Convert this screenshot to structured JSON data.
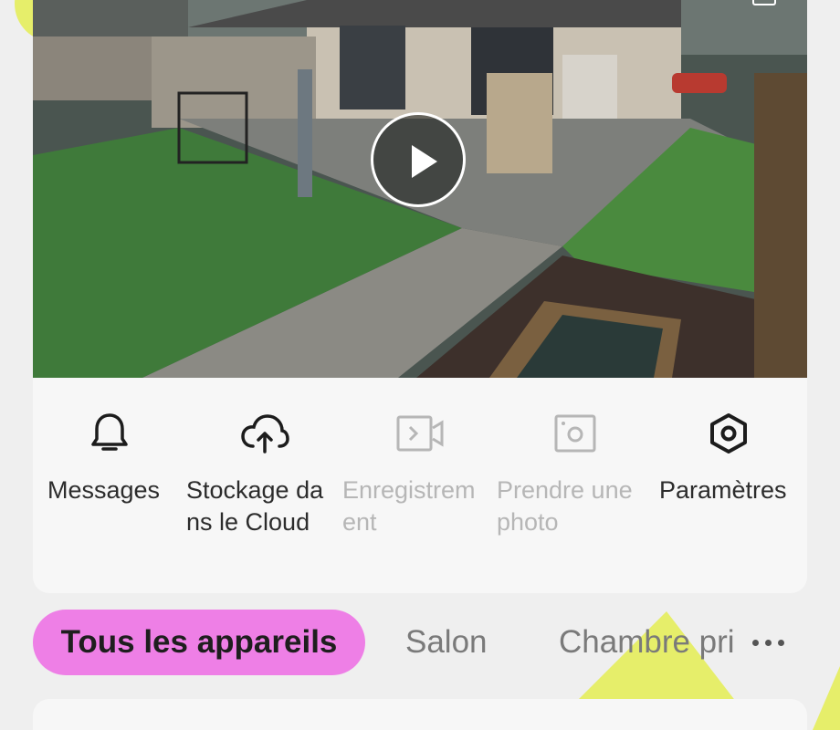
{
  "camera": {
    "play_icon": "play-icon",
    "corner_icon": "expand-icon"
  },
  "actions": [
    {
      "label": "Messages",
      "icon": "bell-icon",
      "enabled": true
    },
    {
      "label": "Stockage dans le Cloud",
      "icon": "cloud-upload-icon",
      "enabled": true
    },
    {
      "label": "Enregistrement",
      "icon": "video-record-icon",
      "enabled": false
    },
    {
      "label": "Prendre une photo",
      "icon": "camera-snapshot-icon",
      "enabled": false
    },
    {
      "label": "Paramètres",
      "icon": "settings-hexagon-icon",
      "enabled": true
    }
  ],
  "tabs": {
    "active": "Tous les appareils",
    "items": [
      "Salon",
      "Chambre pri"
    ],
    "more_icon": "more-dots-icon"
  },
  "colors": {
    "active_tab": "#ee7fe6",
    "decor_yellow": "#e6ee6a",
    "disabled_text": "#b6b6b6"
  }
}
